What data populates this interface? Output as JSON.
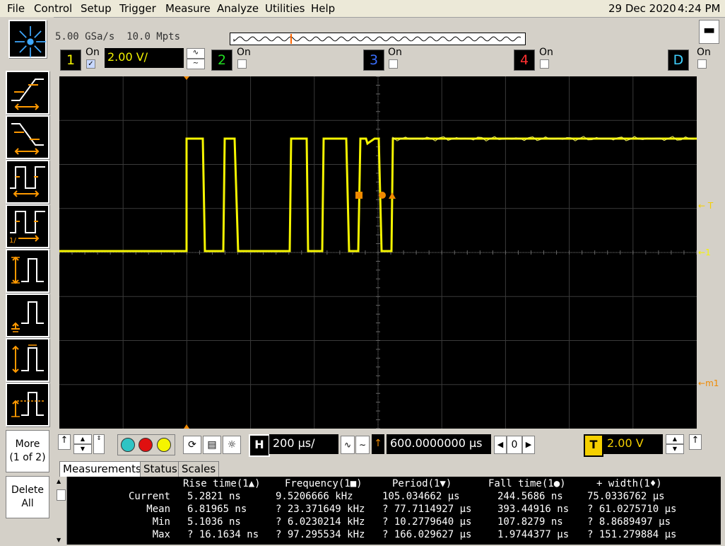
{
  "menu": [
    "File",
    "Control",
    "Setup",
    "Trigger",
    "Measure",
    "Analyze",
    "Utilities",
    "Help"
  ],
  "status": {
    "date": "29 Dec 2020",
    "time": "4:24 PM"
  },
  "acquisition": {
    "sample_rate": "5.00 GSa/s",
    "memory_depth": "10.0 Mpts"
  },
  "channels": [
    {
      "num": "1",
      "on_label": "On",
      "enabled": true,
      "scale": "2.00 V/",
      "color": "#f5f500"
    },
    {
      "num": "2",
      "on_label": "On",
      "enabled": false,
      "color": "#22dd22"
    },
    {
      "num": "3",
      "on_label": "On",
      "enabled": false,
      "color": "#3a6fff"
    },
    {
      "num": "4",
      "on_label": "On",
      "enabled": false,
      "color": "#ff3030"
    },
    {
      "num": "D",
      "on_label": "On",
      "enabled": false,
      "color": "#3fd0ff"
    }
  ],
  "markers": {
    "trigger": "T",
    "ground": "1",
    "math": "m1"
  },
  "side_buttons": {
    "more": "More (1 of 2)",
    "more_l1": "More",
    "more_l2": "(1 of 2)",
    "delete_l1": "Delete",
    "delete_l2": "All"
  },
  "timebase": {
    "scale": "200 µs/",
    "delay": "600.0000000 µs",
    "delay_value": "0",
    "trigger_level": "2.00 V",
    "trigger_label": "T",
    "horiz_label": "H"
  },
  "tabs": [
    "Measurements",
    "Status",
    "Scales"
  ],
  "measurements": {
    "headers": [
      "Rise time(1▲)",
      "Frequency(1■)",
      "Period(1▼)",
      "Fall time(1●)",
      "+ width(1♦)"
    ],
    "rows": [
      {
        "label": "Current",
        "values": [
          "5.2821 ns",
          "9.5206666 kHz",
          "105.034662 µs",
          "244.5686 ns",
          "75.0336762 µs"
        ]
      },
      {
        "label": "Mean",
        "values": [
          "6.81965 ns",
          "? 23.371649 kHz",
          "? 77.7114927 µs",
          "393.44916 ns",
          "? 61.0275710 µs"
        ]
      },
      {
        "label": "Min",
        "values": [
          "5.1036 ns",
          "? 6.0230214 kHz",
          "? 10.2779640 µs",
          "107.8279 ns",
          "? 8.8689497 µs"
        ]
      },
      {
        "label": "Max",
        "values": [
          "? 16.1634 ns",
          "? 97.295534 kHz",
          "? 166.029627 µs",
          "1.9744377 µs",
          "? 151.279884 µs"
        ]
      }
    ]
  }
}
